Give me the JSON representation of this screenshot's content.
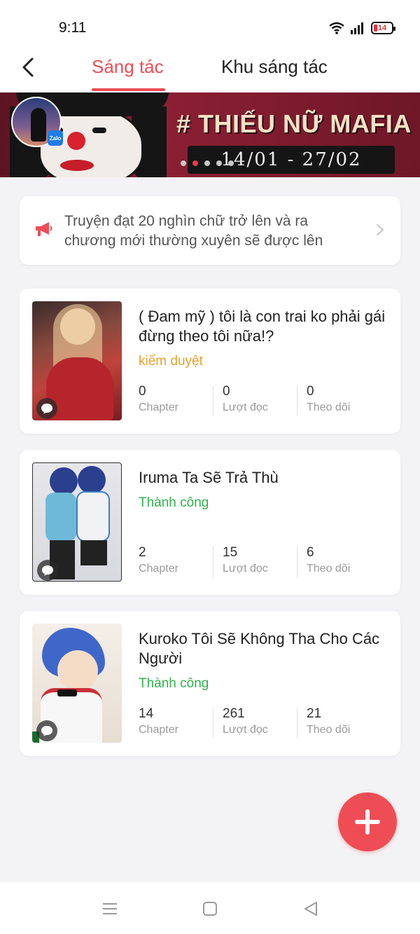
{
  "status_bar": {
    "time": "9:11",
    "battery": "14"
  },
  "header": {
    "tabs": [
      {
        "label": "Sáng tác",
        "active": true
      },
      {
        "label": "Khu sáng tác",
        "active": false
      }
    ]
  },
  "banner": {
    "title": "# THIẾU NỮ MAFIA",
    "date": "14/01 - 27/02",
    "badge": "Zalo",
    "slide_count": 5,
    "active_slide": 2
  },
  "notice": {
    "text": "Truyện đạt 20 nghìn chữ trở lên và ra chương mới thường xuyên sẽ được lên"
  },
  "stories": [
    {
      "title": "( Đam mỹ ) tôi là con trai ko phải gái đừng theo tôi nữa!?",
      "status": "kiểm duyệt",
      "stats": [
        {
          "value": "0",
          "label": "Chapter"
        },
        {
          "value": "0",
          "label": "Lượt đọc"
        },
        {
          "value": "0",
          "label": "Theo dõi"
        }
      ]
    },
    {
      "title": "Iruma Ta Sẽ Trả Thù",
      "status": "Thành công",
      "stats": [
        {
          "value": "2",
          "label": "Chapter"
        },
        {
          "value": "15",
          "label": "Lượt đọc"
        },
        {
          "value": "6",
          "label": "Theo dõi"
        }
      ]
    },
    {
      "title": "Kuroko Tôi Sẽ Không Tha Cho Các Người",
      "status": "Thành công",
      "stats": [
        {
          "value": "14",
          "label": "Chapter"
        },
        {
          "value": "261",
          "label": "Lượt đọc"
        },
        {
          "value": "21",
          "label": "Theo dõi"
        }
      ]
    }
  ],
  "colors": {
    "accent": "#ee4d55",
    "pending": "#e6a12b",
    "success": "#2fb34a",
    "background": "#f3f3f5"
  },
  "icons": {
    "back": "chevron-left-icon",
    "notice": "megaphone-icon",
    "notice_chevron": "chevron-right-icon",
    "cover_badge": "chat-bubble-icon",
    "fab": "plus-icon",
    "nav_menu": "menu-icon",
    "nav_home": "square-icon",
    "nav_back": "triangle-back-icon"
  }
}
